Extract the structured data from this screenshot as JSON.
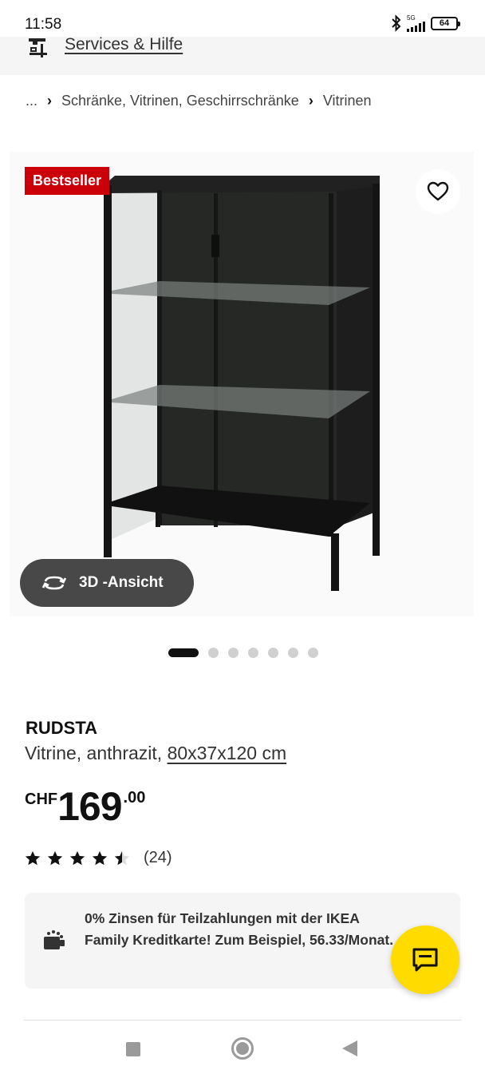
{
  "status_bar": {
    "time": "11:58",
    "network": "5G",
    "battery": "64"
  },
  "services": {
    "link_label": "Services & Hilfe"
  },
  "breadcrumb": {
    "ellipsis": "...",
    "items": [
      "Schränke, Vitrinen, Geschirrschränke",
      "Vitrinen"
    ]
  },
  "product_image": {
    "badge": "Bestseller",
    "view_3d_label": "3D -Ansicht",
    "carousel": {
      "total": 7,
      "active_index": 0
    }
  },
  "product": {
    "name": "RUDSTA",
    "description": "Vitrine, anthrazit,",
    "size": "80x37x120 cm",
    "price": {
      "currency": "CHF",
      "integer": "169",
      "decimal": ".00"
    },
    "rating": {
      "value": 4.5,
      "max": 5,
      "count_label": "(24)"
    }
  },
  "promo": {
    "text": "0% Zinsen für Teilzahlungen mit der IKEA Family Kreditkarte! Zum Beispiel, 56.33/Monat."
  },
  "colors": {
    "badge_red": "#cc0008",
    "chat_yellow": "#ffdb00",
    "button_dark": "#484848",
    "promo_bg": "#f5f5f5"
  },
  "icons": {
    "services": "tools-icon",
    "favorite": "heart-icon",
    "view_3d": "rotate-icon",
    "promo": "installment-icon",
    "chat": "chat-icon"
  }
}
